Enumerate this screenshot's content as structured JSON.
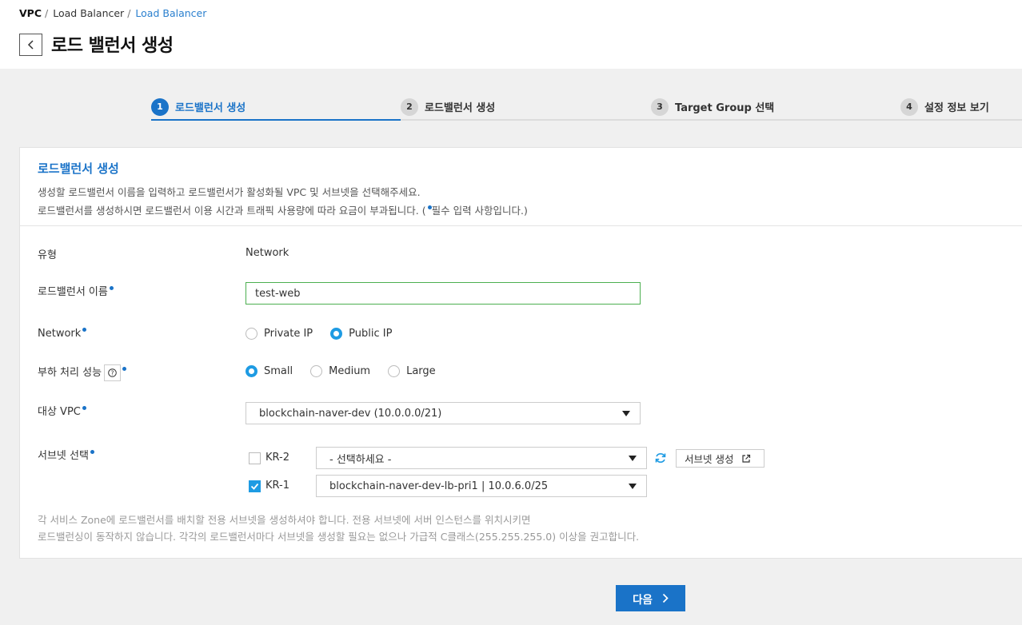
{
  "breadcrumb": {
    "item1": "VPC",
    "item2": "Load Balancer",
    "item3": "Load Balancer",
    "sep": "/"
  },
  "page_title": "로드 밸런서 생성",
  "steps": [
    {
      "num": "1",
      "label": "로드밸런서 생성"
    },
    {
      "num": "2",
      "label": "로드밸런서 생성"
    },
    {
      "num": "3",
      "label": "Target Group 선택"
    },
    {
      "num": "4",
      "label": "설정 정보 보기"
    }
  ],
  "card": {
    "title": "로드밸런서 생성",
    "desc1": "생성할 로드밸런서 이름을 입력하고 로드밸런서가 활성화될 VPC 및 서브넷을 선택해주세요.",
    "desc2a": "로드밸런서를 생성하시면 로드밸런서 이용 시간과 트래픽 사용량에 따라 요금이 부과됩니다. (",
    "desc2b": "필수 입력 사항입니다.)"
  },
  "form": {
    "type_label": "유형",
    "type_value": "Network",
    "name_label": "로드밸런서 이름",
    "name_value": "test-web",
    "network_label": "Network",
    "network_options": [
      "Private IP",
      "Public IP"
    ],
    "perf_label": "부하 처리 성능",
    "perf_options": [
      "Small",
      "Medium",
      "Large"
    ],
    "vpc_label": "대상 VPC",
    "vpc_value": "blockchain-naver-dev (10.0.0.0/21)",
    "subnet_label": "서브넷 선택",
    "zones": [
      {
        "zone": "KR-2",
        "checked": false,
        "value": "- 선택하세요 -"
      },
      {
        "zone": "KR-1",
        "checked": true,
        "value": "blockchain-naver-dev-lb-pri1 | 10.0.6.0/25"
      }
    ],
    "create_subnet": "서브넷 생성",
    "note1": "각 서비스 Zone에 로드밸런서를 배치할 전용 서브넷을 생성하셔야 합니다. 전용 서브넷에 서버 인스턴스를 위치시키면",
    "note2": "로드밸런싱이 동작하지 않습니다. 각각의 로드밸런서마다 서브넷을 생성할 필요는 없으나 가급적 C클래스(255.255.255.0) 이상을 권고합니다."
  },
  "next_button": "다음",
  "colors": {
    "accent": "#1a73c8",
    "radio": "#1e9be3",
    "input_border": "#4caf50"
  },
  "icons": [
    "back-arrow-icon",
    "help-icon",
    "caret-down-icon",
    "refresh-icon",
    "external-link-icon",
    "chevron-right-icon"
  ]
}
